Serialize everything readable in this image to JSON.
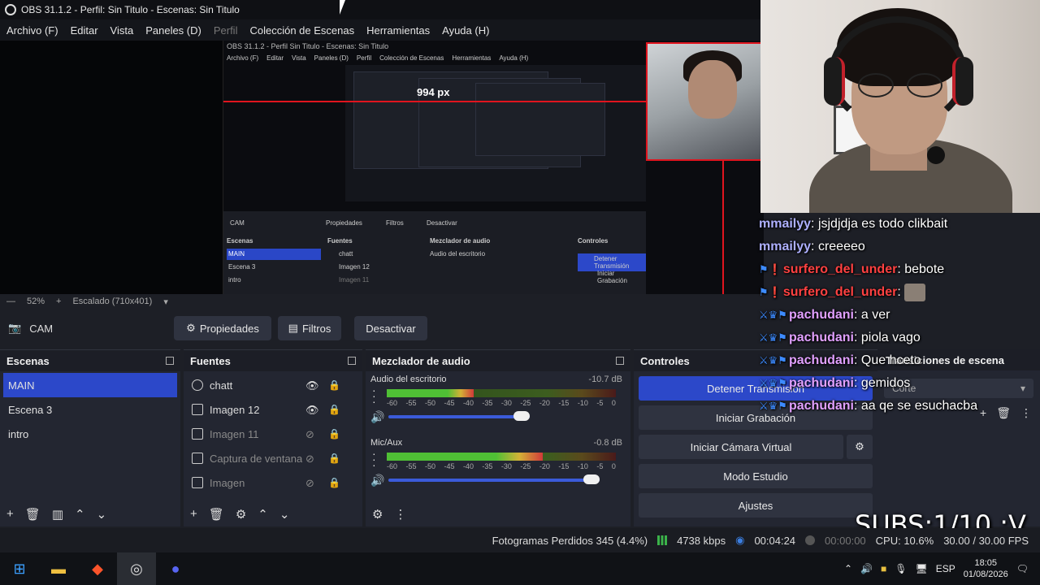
{
  "window": {
    "title": "OBS 31.1.2 - Perfil: Sin Titulo - Escenas: Sin Titulo"
  },
  "menu": [
    {
      "label": "Archivo (F)",
      "enabled": true
    },
    {
      "label": "Editar",
      "enabled": true
    },
    {
      "label": "Vista",
      "enabled": true
    },
    {
      "label": "Paneles (D)",
      "enabled": true
    },
    {
      "label": "Perfil",
      "enabled": false
    },
    {
      "label": "Colección de Escenas",
      "enabled": true
    },
    {
      "label": "Herramientas",
      "enabled": true
    },
    {
      "label": "Ayuda (H)",
      "enabled": true
    }
  ],
  "preview": {
    "nested_title": "OBS 31.1.2 - Perfil Sin Titulo - Escenas: Sin Titulo",
    "px_label": "994 px",
    "zoom": "52%",
    "scale": "Escalado (710x401)"
  },
  "source_toolbar": {
    "source_name": "CAM",
    "properties": "Propiedades",
    "filters": "Filtros",
    "deactivate": "Desactivar"
  },
  "scenes": {
    "title": "Escenas",
    "items": [
      "MAIN",
      "Escena 3",
      "intro"
    ],
    "selected": "MAIN"
  },
  "sources": {
    "title": "Fuentes",
    "items": [
      {
        "name": "chatt",
        "visible": true
      },
      {
        "name": "Imagen 12",
        "visible": true
      },
      {
        "name": "Imagen 11",
        "visible": false
      },
      {
        "name": "Captura de ventana",
        "visible": false
      },
      {
        "name": "Imagen",
        "visible": false
      }
    ]
  },
  "mixer": {
    "title": "Mezclador de audio",
    "scale": [
      "-60",
      "-55",
      "-50",
      "-45",
      "-40",
      "-35",
      "-30",
      "-25",
      "-20",
      "-15",
      "-10",
      "-5",
      "0"
    ],
    "tracks": [
      {
        "name": "Audio del escritorio",
        "db": "-10.7 dB",
        "level": 0.38,
        "volume": 0.62
      },
      {
        "name": "Mic/Aux",
        "db": "-0.8 dB",
        "level": 0.68,
        "volume": 0.93
      }
    ]
  },
  "controls": {
    "title": "Controles",
    "stop_stream": "Detener Transmisión",
    "start_recording": "Iniciar Grabación",
    "virtual_cam": "Iniciar Cámara Virtual",
    "studio_mode": "Modo Estudio",
    "settings": "Ajustes"
  },
  "transitions": {
    "title": "Transiciones de escena",
    "current": "Corte"
  },
  "status": {
    "dropped": "Fotogramas Perdidos 345 (4.4%)",
    "bitrate": "4738 kbps",
    "stream_time": "00:04:24",
    "rec_time": "00:00:00",
    "cpu": "CPU: 10.6%",
    "fps": "30.00 / 30.00 FPS"
  },
  "chat": [
    {
      "user": "mmailyy",
      "text": ": jsjdjdja es todo clikbait",
      "badges": "",
      "style": "mmaily"
    },
    {
      "user": "mmailyy",
      "text": ": creeeeo",
      "badges": "",
      "style": "mmaily"
    },
    {
      "user": "surfero_del_under",
      "text": ": bebote",
      "badges": "⚑❗",
      "style": "surfero"
    },
    {
      "user": "surfero_del_under",
      "text": ": ",
      "badges": "⚑❗",
      "style": "surfero",
      "emote": true
    },
    {
      "user": "pachudani",
      "text": ": a ver",
      "badges": "⚔♛⚑",
      "style": "pachu"
    },
    {
      "user": "pachudani",
      "text": ": piola vago",
      "badges": "⚔♛⚑",
      "style": "pachu"
    },
    {
      "user": "pachudani",
      "text": ": Que hceto",
      "badges": "⚔♛⚑",
      "style": "pachu"
    },
    {
      "user": "pachudani",
      "text": ": gemidos",
      "badges": "⚔♛⚑",
      "style": "pachu"
    },
    {
      "user": "pachudani",
      "text": ": aa qe se esuchacba",
      "badges": "⚔♛⚑",
      "style": "pachu"
    }
  ],
  "overlay": {
    "subs": "SUBS:1/10 :V"
  },
  "taskbar": {
    "lang": "ESP",
    "time": "18:05",
    "date": "01/08/2026"
  },
  "colors": {
    "accent": "#2c48c9",
    "meter_green": "#4fbf35",
    "red_guide": "#e0141e"
  }
}
